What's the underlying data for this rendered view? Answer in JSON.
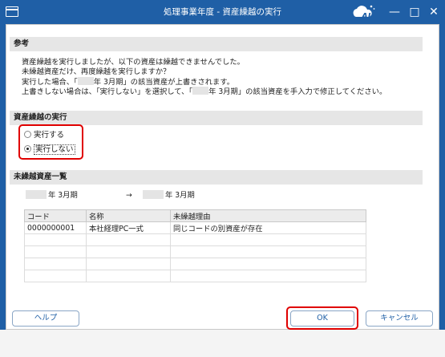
{
  "window": {
    "title": "処理事業年度 - 資産繰越の実行",
    "logo_text": "AI",
    "minimize_glyph": "—",
    "maximize_glyph": "□",
    "close_glyph": "✕",
    "accent_color": "#1f5fa6",
    "highlight_color": "#e00000"
  },
  "reference": {
    "header": "参考",
    "line1": "資産繰越を実行しましたが、以下の資産は繰越できませんでした。",
    "line2": "未繰越資産だけ、再度繰越を実行しますか？",
    "line3_pre": "実行した場合、「",
    "line3_post": "年  3月期」の該当資産が上書きされます。",
    "line4_pre": "上書きしない場合は、「実行しない」を選択して、「",
    "line4_post": "年  3月期」の該当資産を手入力で修正してください。"
  },
  "execution": {
    "header": "資産繰越の実行",
    "options": [
      {
        "label": "実行する",
        "selected": false
      },
      {
        "label": "実行しない",
        "selected": true
      }
    ]
  },
  "unforwarded": {
    "header": "未繰越資産一覧",
    "from_period": "年  3月期",
    "arrow": "→",
    "to_period": "年  3月期",
    "columns": [
      "コード",
      "名称",
      "未繰越理由"
    ],
    "rows": [
      [
        "0000000001",
        "本社経理PC一式",
        "同じコードの別資産が存在"
      ],
      [
        "",
        "",
        ""
      ],
      [
        "",
        "",
        ""
      ],
      [
        "",
        "",
        ""
      ],
      [
        "",
        "",
        ""
      ]
    ]
  },
  "buttons": {
    "help": "ヘルプ",
    "ok": "OK",
    "cancel": "キャンセル"
  }
}
